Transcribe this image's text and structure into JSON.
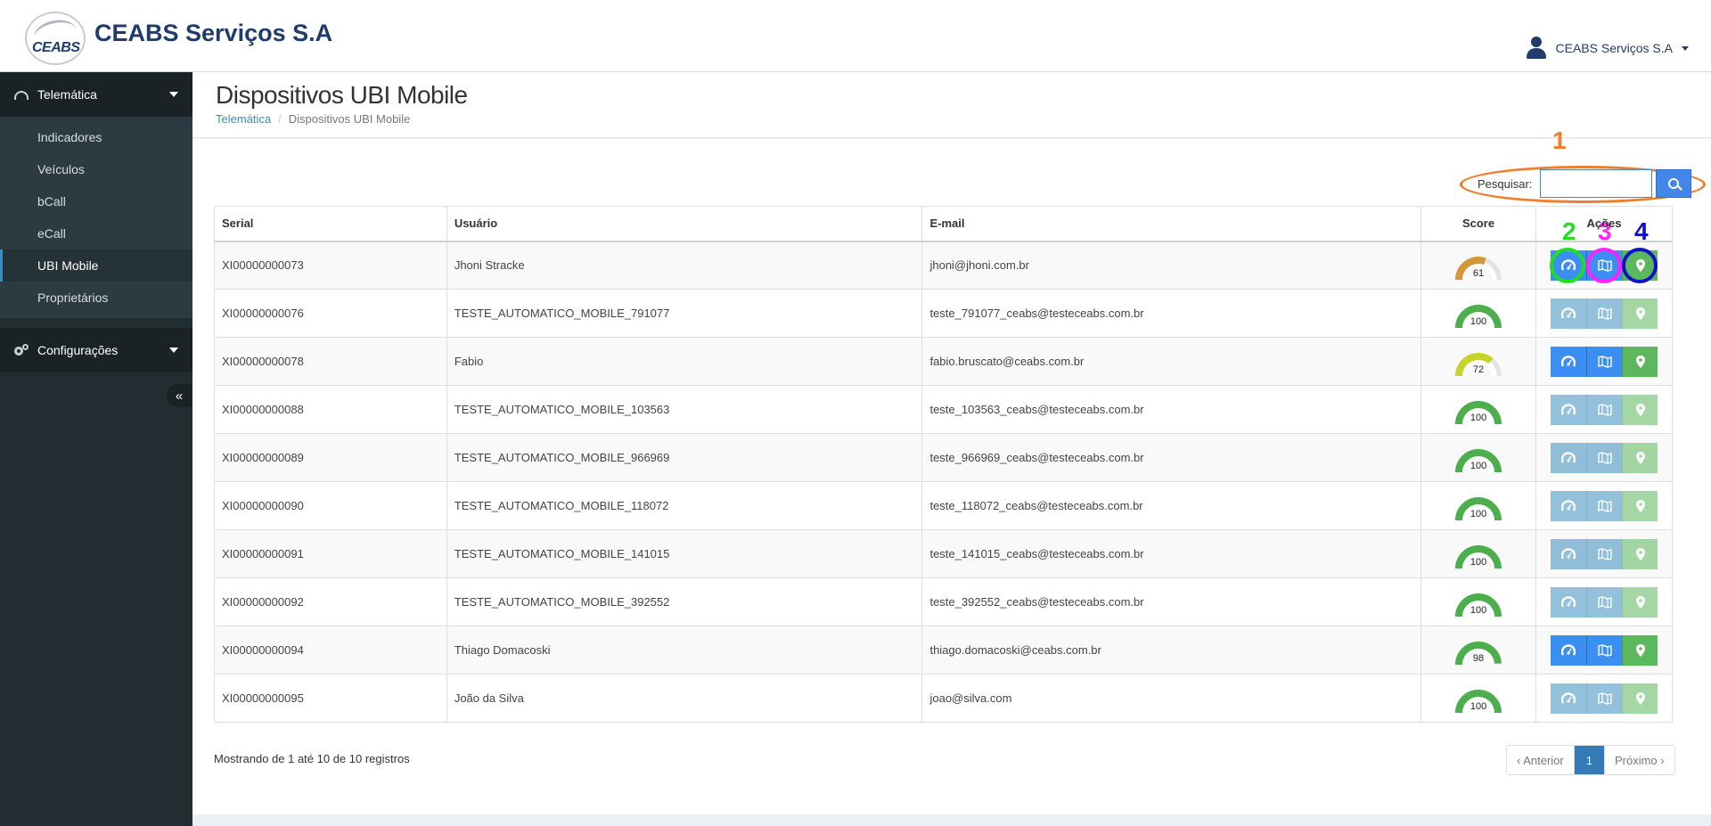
{
  "header": {
    "brand": "CEABS Serviços S.A",
    "logo_text": "CEABS",
    "user_name": "CEABS Serviços S.A"
  },
  "sidebar": {
    "group1": {
      "label": "Telemática",
      "icon": "dashboard-icon"
    },
    "items": [
      {
        "label": "Indicadores"
      },
      {
        "label": "Veículos"
      },
      {
        "label": "bCall"
      },
      {
        "label": "eCall"
      },
      {
        "label": "UBI Mobile",
        "active": true
      },
      {
        "label": "Proprietários"
      }
    ],
    "group2": {
      "label": "Configurações",
      "icon": "cogs-icon"
    },
    "collapse_glyph": "«"
  },
  "page": {
    "title": "Dispositivos UBI Mobile",
    "breadcrumb": {
      "root": "Telemática",
      "sep": "/",
      "current": "Dispositivos UBI Mobile"
    }
  },
  "search": {
    "label": "Pesquisar:",
    "value": ""
  },
  "annotations": [
    {
      "text": "1",
      "color": "#f07f2d"
    },
    {
      "text": "2",
      "color": "#22dd22"
    },
    {
      "text": "3",
      "color": "#ff22ff"
    },
    {
      "text": "4",
      "color": "#1111cc"
    }
  ],
  "table": {
    "headers": {
      "serial": "Serial",
      "user": "Usuário",
      "email": "E-mail",
      "score": "Score",
      "acoes": "Ações"
    },
    "rows": [
      {
        "serial": "XI00000000073",
        "user": "Jhoni Stracke",
        "email": "jhoni@jhoni.com.br",
        "score": 61,
        "score_color": "#d4983a",
        "active": true
      },
      {
        "serial": "XI00000000076",
        "user": "TESTE_AUTOMATICO_MOBILE_791077",
        "email": "teste_791077_ceabs@testeceabs.com.br",
        "score": 100,
        "score_color": "#4cae4c",
        "active": false
      },
      {
        "serial": "XI00000000078",
        "user": "Fabio",
        "email": "fabio.bruscato@ceabs.com.br",
        "score": 72,
        "score_color": "#c5d32a",
        "active": true
      },
      {
        "serial": "XI00000000088",
        "user": "TESTE_AUTOMATICO_MOBILE_103563",
        "email": "teste_103563_ceabs@testeceabs.com.br",
        "score": 100,
        "score_color": "#4cae4c",
        "active": false
      },
      {
        "serial": "XI00000000089",
        "user": "TESTE_AUTOMATICO_MOBILE_966969",
        "email": "teste_966969_ceabs@testeceabs.com.br",
        "score": 100,
        "score_color": "#4cae4c",
        "active": false
      },
      {
        "serial": "XI00000000090",
        "user": "TESTE_AUTOMATICO_MOBILE_118072",
        "email": "teste_118072_ceabs@testeceabs.com.br",
        "score": 100,
        "score_color": "#4cae4c",
        "active": false
      },
      {
        "serial": "XI00000000091",
        "user": "TESTE_AUTOMATICO_MOBILE_141015",
        "email": "teste_141015_ceabs@testeceabs.com.br",
        "score": 100,
        "score_color": "#4cae4c",
        "active": false
      },
      {
        "serial": "XI00000000092",
        "user": "TESTE_AUTOMATICO_MOBILE_392552",
        "email": "teste_392552_ceabs@testeceabs.com.br",
        "score": 100,
        "score_color": "#4cae4c",
        "active": false
      },
      {
        "serial": "XI00000000094",
        "user": "Thiago Domacoski",
        "email": "thiago.domacoski@ceabs.com.br",
        "score": 98,
        "score_color": "#4cae4c",
        "active": true
      },
      {
        "serial": "XI00000000095",
        "user": "João da Silva",
        "email": "joao@silva.com",
        "score": 100,
        "score_color": "#4cae4c",
        "active": false
      }
    ],
    "action_icons": [
      "dashboard-icon",
      "map-icon",
      "map-marker-icon"
    ]
  },
  "footer": {
    "info": "Mostrando de 1 até 10 de 10 registros",
    "prev": "‹ Anterior",
    "page": "1",
    "next": "Próximo ›"
  }
}
